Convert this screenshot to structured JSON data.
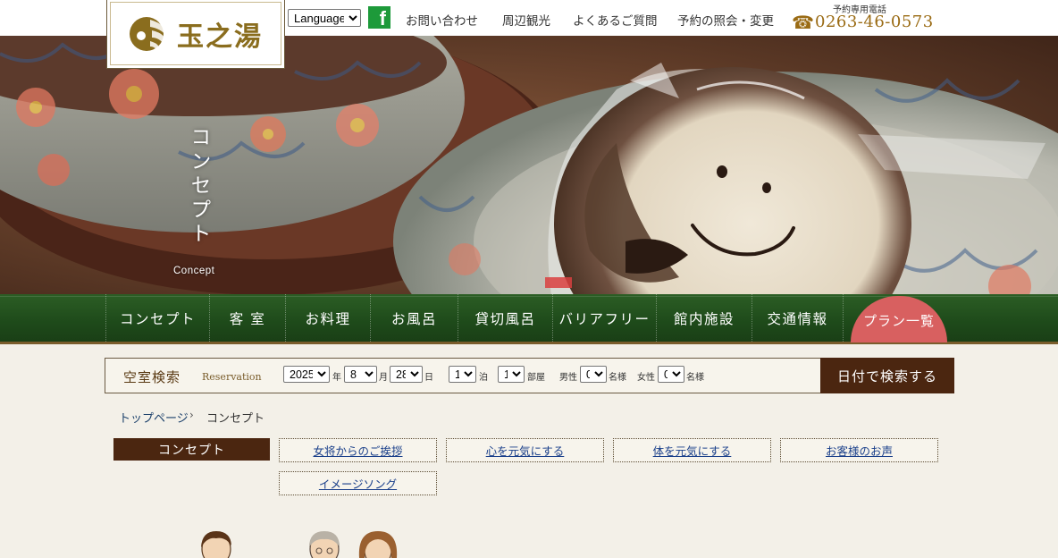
{
  "header": {
    "logo_text": "玉之湯",
    "language_select": "Language",
    "facebook_glyph": "f",
    "links": [
      "お問い合わせ",
      "周辺観光",
      "よくあるご質問",
      "予約の照会・変更"
    ],
    "phone_label": "予約専用電話",
    "phone_number": "0263-46-0573",
    "phone_icon": "telephone-icon"
  },
  "hero": {
    "title": "コンセプト",
    "subtitle": "Concept"
  },
  "nav": {
    "items": [
      "コンセプト",
      "客 室",
      "お料理",
      "お風呂",
      "貸切風呂",
      "バリアフリー",
      "館内施設",
      "交通情報"
    ],
    "plan_button": "プラン一覧"
  },
  "reservation": {
    "title": "空室検索",
    "subtitle": "Reservation",
    "year": "2025",
    "year_unit": "年",
    "month": "8",
    "month_unit": "月",
    "day": "28",
    "day_unit": "日",
    "nights": "1",
    "nights_unit": "泊",
    "rooms": "1",
    "rooms_unit": "部屋",
    "male_label": "男性",
    "male": "0",
    "male_unit": "名様",
    "female_label": "女性",
    "female": "0",
    "female_unit": "名様",
    "search_button": "日付で検索する"
  },
  "breadcrumb": {
    "home": "トップページ",
    "separator": "›",
    "current": "コンセプト"
  },
  "subnav": {
    "active": "コンセプト",
    "links": [
      "女将からのご挨拶",
      "心を元気にする",
      "体を元気にする",
      "お客様のお声",
      "イメージソング"
    ]
  },
  "colors": {
    "nav_green": "#1e4a1a",
    "dark_brown": "#4b2610",
    "plan_red": "#d86060",
    "phone_gold": "#9a6b14",
    "link_blue": "#1a3f8a"
  }
}
